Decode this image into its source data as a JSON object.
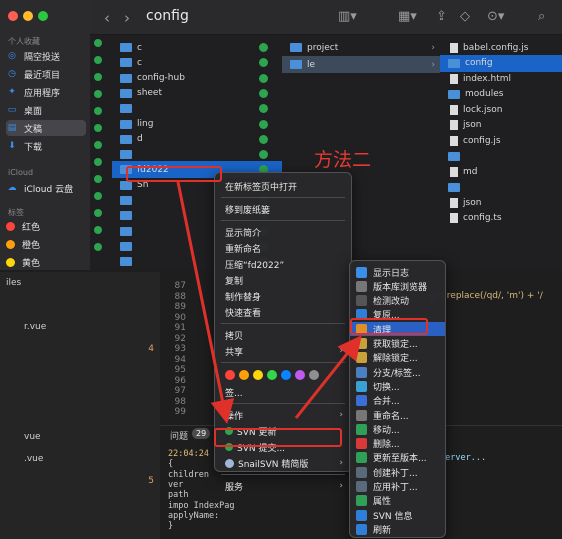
{
  "finder": {
    "title": "config",
    "sidebar": {
      "section_favorites": "个人收藏",
      "favorites": [
        {
          "icon": "airdrop-icon",
          "label": "隔空投送"
        },
        {
          "icon": "clock-icon",
          "label": "最近项目"
        },
        {
          "icon": "apps-icon",
          "label": "应用程序"
        },
        {
          "icon": "desktop-icon",
          "label": "桌面"
        },
        {
          "icon": "document-icon",
          "label": "文稿"
        },
        {
          "icon": "download-icon",
          "label": "下载"
        }
      ],
      "section_icloud": "iCloud",
      "icloud": [
        {
          "icon": "cloud-icon",
          "label": "iCloud 云盘"
        }
      ],
      "section_tags": "标签",
      "tags": [
        {
          "color": "#ff453a",
          "label": "红色"
        },
        {
          "color": "#ff9f0a",
          "label": "橙色"
        },
        {
          "color": "#ffd60a",
          "label": "黄色"
        }
      ]
    },
    "col1": [
      "c",
      "c",
      "config-hub",
      "sheet",
      "",
      "ling",
      "d",
      "",
      "fd2022",
      "Sn",
      "",
      "",
      "",
      "",
      "",
      ""
    ],
    "col1_selected": "fd2022",
    "col2": [
      "project",
      "le"
    ],
    "col3": [
      "babel.config.js",
      "config",
      "index.html",
      "modules",
      "lock.json",
      "json",
      "config.js",
      "",
      "md",
      "",
      "json",
      "config.ts"
    ]
  },
  "context_menu": {
    "items": [
      {
        "label": "在新标签页中打开",
        "type": "item"
      },
      {
        "type": "sep"
      },
      {
        "label": "移到废纸篓",
        "type": "item"
      },
      {
        "type": "sep"
      },
      {
        "label": "显示简介",
        "type": "item"
      },
      {
        "label": "重新命名",
        "type": "item"
      },
      {
        "label": "压缩“fd2022”",
        "type": "item"
      },
      {
        "label": "复制",
        "type": "item"
      },
      {
        "label": "制作替身",
        "type": "item"
      },
      {
        "label": "快速查看",
        "type": "item"
      },
      {
        "type": "sep"
      },
      {
        "label": "拷贝",
        "type": "item"
      },
      {
        "label": "共享",
        "type": "submenu"
      },
      {
        "type": "sep"
      },
      {
        "type": "colors"
      },
      {
        "label": "签...",
        "type": "item"
      },
      {
        "type": "sep"
      },
      {
        "label": "操作",
        "type": "submenu"
      },
      {
        "label": "SVN 更新",
        "type": "item"
      },
      {
        "label": "SVN 提交...",
        "type": "item"
      },
      {
        "label": "SnailSVN 精简版",
        "type": "submenu"
      },
      {
        "type": "sep"
      },
      {
        "label": "服务",
        "type": "submenu"
      }
    ],
    "tag_colors": [
      "#ff453a",
      "#ff9f0a",
      "#ffd60a",
      "#32d74b",
      "#0a84ff",
      "#bf5af2",
      "#8e8e93"
    ]
  },
  "svn_submenu": {
    "items": [
      {
        "icon": "log-icon",
        "color": "#3b8eea",
        "label": "显示日志"
      },
      {
        "icon": "repo-browser-icon",
        "color": "#777",
        "label": "版本库浏览器"
      },
      {
        "icon": "check-icon",
        "color": "#555",
        "label": "检测改动"
      },
      {
        "icon": "revert-icon",
        "color": "#2f7fd8",
        "label": "复原..."
      },
      {
        "icon": "cleanup-icon",
        "color": "#e0902a",
        "label": "清理"
      },
      {
        "icon": "lock-icon",
        "color": "#c9a13b",
        "label": "获取锁定..."
      },
      {
        "icon": "unlock-icon",
        "color": "#c9a13b",
        "label": "解除锁定..."
      },
      {
        "icon": "branch-icon",
        "color": "#4a7fc1",
        "label": "分支/标签..."
      },
      {
        "icon": "switch-icon",
        "color": "#3aa0d8",
        "label": "切换..."
      },
      {
        "icon": "merge-icon",
        "color": "#3a6fd8",
        "label": "合并..."
      },
      {
        "icon": "rename-icon",
        "color": "#777",
        "label": "重命名..."
      },
      {
        "icon": "move-icon",
        "color": "#2fa055",
        "label": "移动..."
      },
      {
        "icon": "delete-icon",
        "color": "#d83a3a",
        "label": "删除..."
      },
      {
        "icon": "update-to-rev-icon",
        "color": "#2fa055",
        "label": "更新至版本..."
      },
      {
        "icon": "create-patch-icon",
        "color": "#5a6a7a",
        "label": "创建补丁..."
      },
      {
        "icon": "apply-patch-icon",
        "color": "#5a6a7a",
        "label": "应用补丁..."
      },
      {
        "icon": "properties-icon",
        "color": "#2fa055",
        "label": "属性"
      },
      {
        "icon": "svn-info-icon",
        "color": "#2f7fd8",
        "label": "SVN 信息"
      },
      {
        "icon": "refresh-icon",
        "color": "#2f7fd8",
        "label": "刷新"
      }
    ]
  },
  "annotation": "方法二",
  "editor": {
    "line_numbers": [
      "87",
      "88",
      "89",
      "90",
      "91",
      "92",
      "93",
      "94",
      "95",
      "96",
      "97",
      "98",
      "99"
    ],
    "code_snippet": "gin.replace(/qd/, 'm') + '/",
    "problems_tab": "问题",
    "problems_count": "29",
    "terminal_lines": [
      "22:04:24",
      "{",
      "  children",
      "  ver",
      "  path",
      "  impo    IndexPag",
      "  applyName:",
      "}"
    ],
    "terminal_right": "server...",
    "explorer_items": [
      {
        "label": "r.vue",
        "badge": ""
      },
      {
        "label": "",
        "badge": "4"
      },
      {
        "label": "",
        "badge": ""
      },
      {
        "label": "",
        "badge": ""
      },
      {
        "label": "",
        "badge": ""
      },
      {
        "label": "vue",
        "badge": ""
      },
      {
        "label": ".vue",
        "badge": ""
      },
      {
        "label": "",
        "badge": "5"
      }
    ],
    "explorer_top": "iles"
  }
}
